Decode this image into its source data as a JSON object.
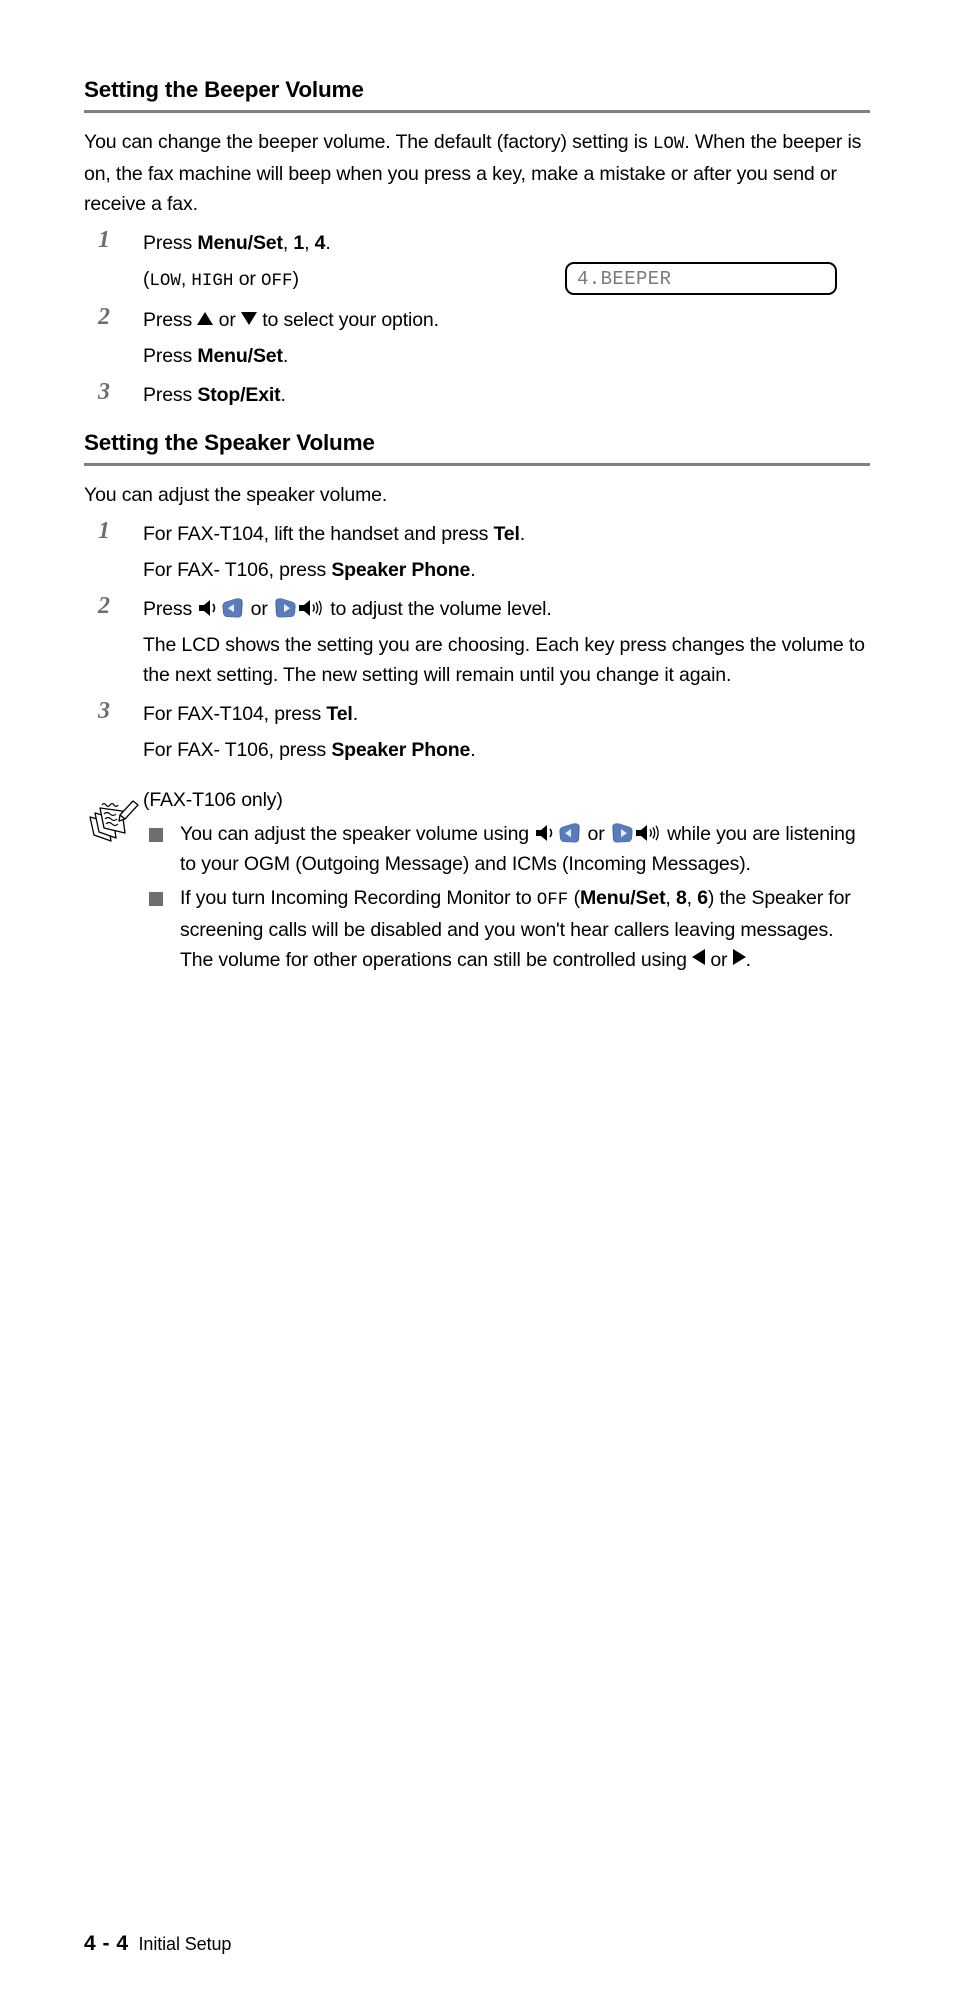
{
  "page": {
    "footer_page_number": "4 - 4",
    "footer_section": "Initial Setup"
  },
  "sections": [
    {
      "heading": "Setting the Beeper Volume",
      "intro_1": "You can change the beeper volume. The default (factory) setting is ",
      "intro_mono": "LOW",
      "intro_2": ". When the beeper is on, the fax machine will beep when you press a key, make a mistake or after you send or receive a fax.",
      "steps": [
        {
          "num": "1",
          "line1_pre": "Press ",
          "line1_bold": "Menu/Set",
          "line1_mid": ", ",
          "line1_bold2": "1",
          "line1_mid2": ", ",
          "line1_bold3": "4",
          "line1_post": ".",
          "line2_open": "(",
          "line2_opt1": "LOW",
          "line2_sep1": ", ",
          "line2_opt2": "HIGH",
          "line2_sep2": " or ",
          "line2_opt3": "OFF",
          "line2_close": ")"
        },
        {
          "num": "2",
          "line1_pre": "Press ",
          "line1_mid": " or ",
          "line1_post": " to select your option.",
          "line2_pre": "Press ",
          "line2_bold": "Menu/Set",
          "line2_post": "."
        },
        {
          "num": "3",
          "line1_pre": "Press ",
          "line1_bold": "Stop/Exit",
          "line1_post": "."
        }
      ],
      "lcd": {
        "name": "lcd-beeper",
        "text": "4.BEEPER"
      }
    },
    {
      "heading": "Setting the Speaker Volume",
      "intro": "You can adjust the speaker volume.",
      "steps": [
        {
          "num": "1",
          "line1_pre": "For FAX-T104, lift the handset and press ",
          "line1_bold": "Tel",
          "line1_post": ".",
          "line2_pre": "For FAX- T106, press ",
          "line2_bold": "Speaker Phone",
          "line2_post": "."
        },
        {
          "num": "2",
          "line1_pre": "Press ",
          "line1_mid": " or ",
          "line1_post": " to adjust the volume level.",
          "body": "The LCD shows the setting you are choosing. Each key press changes the volume to the next setting. The new setting will remain until you change it again."
        },
        {
          "num": "3",
          "line1_pre": "For FAX-T104, press ",
          "line1_bold": "Tel",
          "line1_post": ".",
          "line2_pre": "For FAX- T106, press ",
          "line2_bold": "Speaker Phone",
          "line2_post": "."
        }
      ]
    }
  ],
  "note": {
    "icon": "notepad-pencil-icon",
    "title": "(FAX-T106 only)",
    "bullets": [
      {
        "pre": "You can adjust the speaker volume using ",
        "mid": " or ",
        "post": " while you are listening to your OGM (Outgoing Message) and ICMs (Incoming Messages)."
      },
      {
        "pre": "If you turn Incoming Recording Monitor to ",
        "mono": "OFF",
        "mid1": " (",
        "bold1": "Menu/Set",
        "mid2": ", ",
        "bold2": "8",
        "mid3": ", ",
        "bold3": "6",
        "mid4": ") the Speaker for screening calls will be disabled and you won't hear callers leaving messages. The volume for other operations can still be controlled using ",
        "mid5": " or ",
        "post": "."
      }
    ]
  },
  "colors": {
    "rule": "#808080",
    "step_number": "#6e6e6e",
    "bullet": "#6e6e6e",
    "lcd_text": "#7a7a7a",
    "key_blue": "#5a7cbd",
    "key_blue_dark": "#3f5d96"
  },
  "icons": {
    "speaker_low": "speaker-low-icon",
    "speaker_high": "speaker-high-icon",
    "key_left": "left-arrow-key-icon",
    "key_right": "right-arrow-key-icon",
    "arrow_up": "up-triangle-icon",
    "arrow_down": "down-triangle-icon",
    "arrow_left": "left-triangle-icon",
    "arrow_right": "right-triangle-icon"
  }
}
